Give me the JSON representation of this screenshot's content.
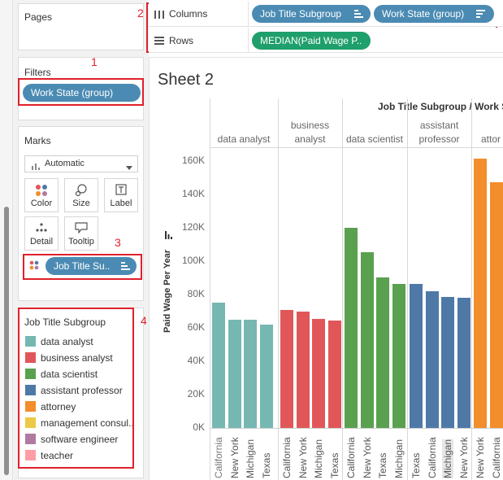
{
  "left": {
    "pages_title": "Pages",
    "filters_title": "Filters",
    "filter_pill": "Work State (group)",
    "marks_title": "Marks",
    "mark_type": "Automatic",
    "mark_buttons": [
      "Color",
      "Size",
      "Label",
      "Detail",
      "Tooltip"
    ],
    "marks_pill": "Job Title Su..",
    "legend_title": "Job Title Subgroup",
    "legend": [
      {
        "label": "data analyst",
        "color": "#76b7b2"
      },
      {
        "label": "business analyst",
        "color": "#e15759"
      },
      {
        "label": "data scientist",
        "color": "#59a14f"
      },
      {
        "label": "assistant professor",
        "color": "#4e79a7"
      },
      {
        "label": "attorney",
        "color": "#f28e2b"
      },
      {
        "label": "management consul..",
        "color": "#edc948"
      },
      {
        "label": "software engineer",
        "color": "#b07aa1"
      },
      {
        "label": "teacher",
        "color": "#ff9da7"
      }
    ]
  },
  "shelves": {
    "columns_label": "Columns",
    "columns_pills": [
      "Job Title Subgroup",
      "Work State (group)"
    ],
    "rows_label": "Rows",
    "rows_pill": "MEDIAN(Paid Wage P.."
  },
  "annotations": [
    "1",
    "2",
    "3",
    "4"
  ],
  "sheet": {
    "title": "Sheet 2",
    "header": "Job Title Subgroup / Work St",
    "ylabel": "Paid Wage Per Year",
    "yticks": [
      "160K",
      "140K",
      "120K",
      "100K",
      "80K",
      "60K",
      "40K",
      "20K",
      "0K"
    ]
  },
  "chart_data": {
    "type": "bar",
    "ylabel": "Paid Wage Per Year",
    "ylim": [
      0,
      168000
    ],
    "groups": [
      {
        "name": "data analyst",
        "head": [
          "data analyst"
        ],
        "color": "#76b7b2",
        "bars": [
          {
            "x": "California",
            "y": 75000
          },
          {
            "x": "New York",
            "y": 65000
          },
          {
            "x": "Michigan",
            "y": 65000
          },
          {
            "x": "Texas",
            "y": 62000
          }
        ]
      },
      {
        "name": "business analyst",
        "head": [
          "business",
          "analyst"
        ],
        "color": "#e15759",
        "bars": [
          {
            "x": "California",
            "y": 70500
          },
          {
            "x": "New York",
            "y": 69500
          },
          {
            "x": "Michigan",
            "y": 65500
          },
          {
            "x": "Texas",
            "y": 64500
          }
        ]
      },
      {
        "name": "data scientist",
        "head": [
          "data scientist"
        ],
        "color": "#59a14f",
        "bars": [
          {
            "x": "California",
            "y": 120000
          },
          {
            "x": "New York",
            "y": 105000
          },
          {
            "x": "Texas",
            "y": 90000
          },
          {
            "x": "Michigan",
            "y": 86000
          }
        ]
      },
      {
        "name": "assistant professor",
        "head": [
          "assistant",
          "professor"
        ],
        "color": "#4e79a7",
        "bars": [
          {
            "x": "Texas",
            "y": 86000
          },
          {
            "x": "California",
            "y": 82000
          },
          {
            "x": "Michigan",
            "y": 78500
          },
          {
            "x": "New York",
            "y": 78000
          }
        ]
      },
      {
        "name": "attorney",
        "head": [
          "attor"
        ],
        "color": "#f28e2b",
        "bars": [
          {
            "x": "New York",
            "y": 161000
          },
          {
            "x": "California",
            "y": 147000
          }
        ]
      }
    ]
  }
}
